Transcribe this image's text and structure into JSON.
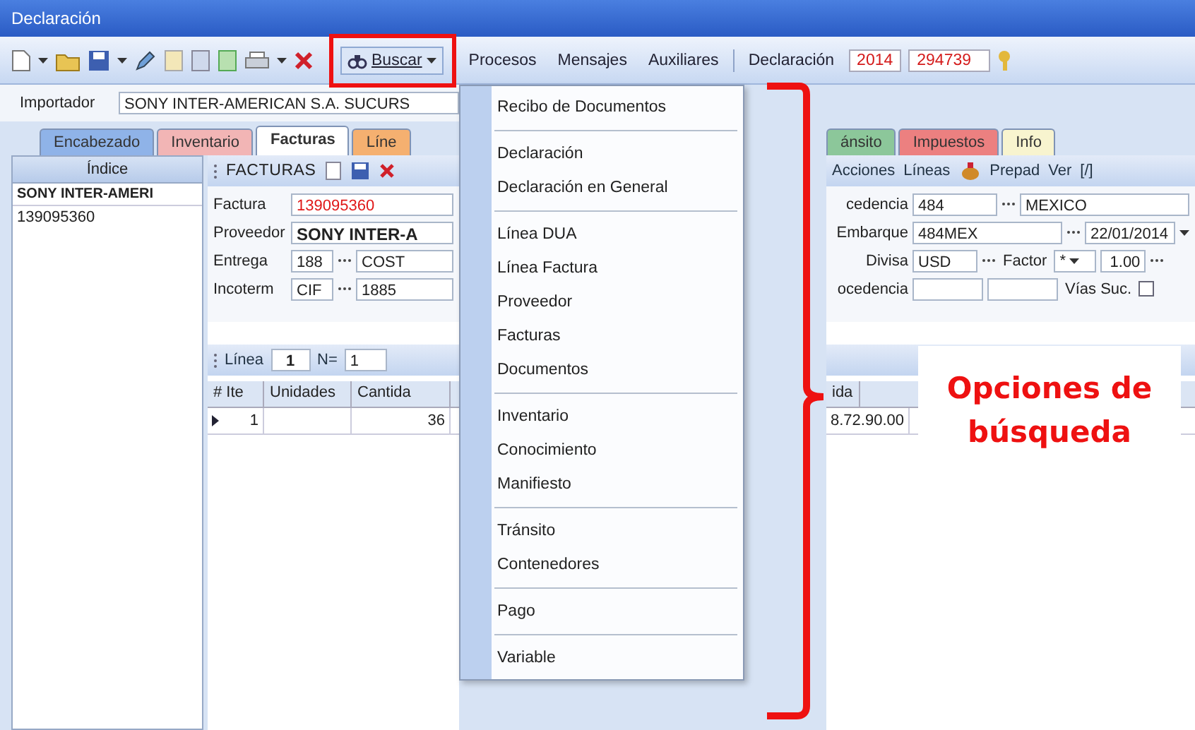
{
  "window": {
    "title": "Declaración"
  },
  "toolbar": {
    "search_button": {
      "label": "Buscar",
      "open": true
    },
    "menus": [
      "Procesos",
      "Mensajes",
      "Auxiliares"
    ],
    "declaration_label": "Declaración",
    "year": "2014",
    "number": "294739"
  },
  "importer": {
    "label": "Importador",
    "value": "SONY INTER-AMERICAN S.A. SUCURS"
  },
  "tabs_left": [
    {
      "label": "Encabezado",
      "color": "#8fb3e8",
      "selected": false
    },
    {
      "label": "Inventario",
      "color": "#f2b5b5",
      "selected": false
    },
    {
      "label": "Facturas",
      "color": "#ffffff",
      "selected": true
    },
    {
      "label": "Líne",
      "color": "#f5b070",
      "selected": false
    }
  ],
  "tabs_right": [
    {
      "label": "ánsito",
      "color": "#8cc79a",
      "selected": false
    },
    {
      "label": "Impuestos",
      "color": "#ec8080",
      "selected": false
    },
    {
      "label": "Info",
      "color": "#f8f4cf",
      "selected": false
    }
  ],
  "index_panel": {
    "title": "Índice",
    "items": [
      {
        "label": "SONY INTER-AMERI",
        "kind": "group"
      },
      {
        "label": "139095360",
        "kind": "item"
      }
    ]
  },
  "invoice_panel": {
    "title": "FACTURAS",
    "fields": [
      {
        "label": "Factura",
        "value": "139095360",
        "kind": "number"
      },
      {
        "label": "Proveedor",
        "value": "SONY INTER-A",
        "kind": "name"
      },
      {
        "label": "Entrega",
        "code": "188",
        "value": "COST",
        "kind": "lookup"
      },
      {
        "label": "Incoterm",
        "code": "CIF",
        "value": "1885",
        "kind": "lookup"
      }
    ],
    "line_bar": {
      "label": "Línea",
      "value": "1",
      "count_label": "N=",
      "count": "1"
    },
    "grid": {
      "columns": [
        "# Ite",
        "Unidades",
        "Cantida"
      ],
      "rows": [
        {
          "current": true,
          "item": "1",
          "quantity": "36"
        }
      ]
    }
  },
  "right_pane": {
    "panel_menu": [
      "Acciones",
      "Líneas"
    ],
    "prepaid": "Prepad",
    "view": "Ver",
    "toggle": "[/]",
    "fields": [
      {
        "label": "cedencia",
        "code": "484",
        "value": "MEXICO",
        "kind": "lookup"
      },
      {
        "label": "Embarque",
        "code": "484MEX",
        "value": "22/01/2014",
        "kind": "date"
      },
      {
        "label": "Divisa",
        "code": "USD",
        "factor_label": "Factor",
        "factor": "*",
        "value": "1.00",
        "kind": "currency"
      },
      {
        "label": "ocedencia",
        "checkbox_label": "Vías Suc.",
        "checked": false,
        "kind": "blank"
      }
    ],
    "grid": {
      "column": "ida",
      "cell": "8.72.90.00"
    }
  },
  "search_menu": {
    "groups": [
      [
        "Recibo de Documentos"
      ],
      [
        "Declaración",
        "Declaración en General"
      ],
      [
        "Línea DUA",
        "Línea Factura",
        "Proveedor",
        "Facturas",
        "Documentos"
      ],
      [
        "Inventario",
        "Conocimiento",
        "Manifiesto"
      ],
      [
        "Tránsito",
        "Contenedores"
      ],
      [
        "Pago"
      ],
      [
        "Variable"
      ]
    ]
  },
  "callout": "Opciones de búsqueda"
}
